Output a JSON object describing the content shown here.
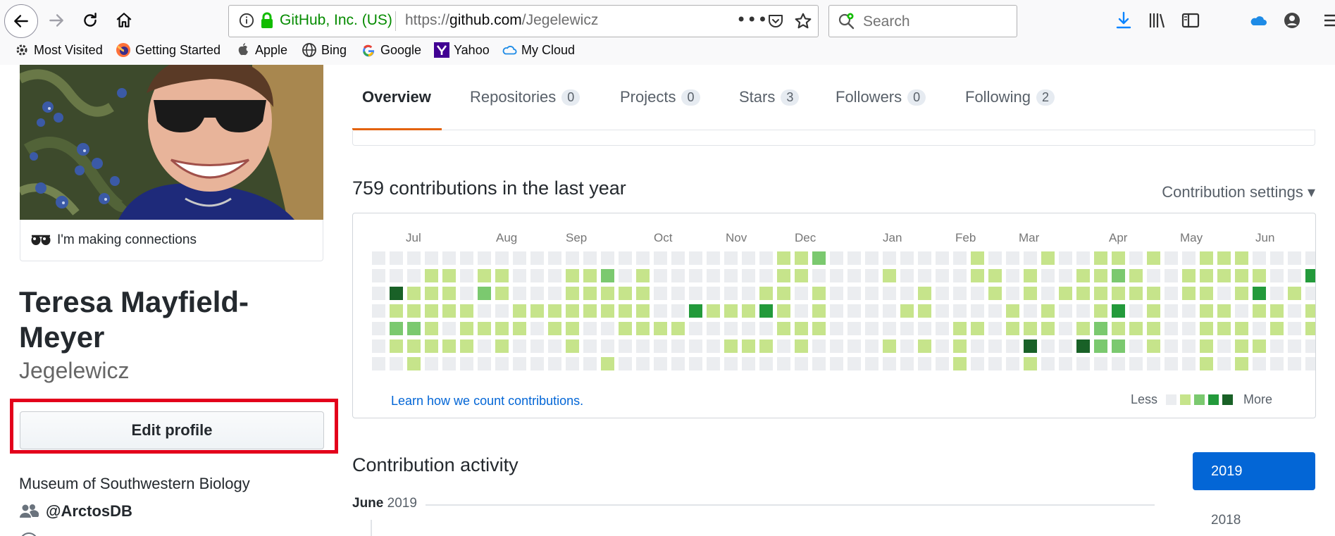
{
  "browser": {
    "url_org": "GitHub, Inc. (US)",
    "url_prefix": "https://",
    "url_host": "github.com",
    "url_path": "/Jegelewicz",
    "url_more": "•••",
    "search_placeholder": "Search",
    "bookmarks": [
      {
        "label": "Most Visited",
        "icon": "gear-icon"
      },
      {
        "label": "Getting Started",
        "icon": "firefox-icon"
      },
      {
        "label": "Apple",
        "icon": "apple-icon"
      },
      {
        "label": "Bing",
        "icon": "globe-icon"
      },
      {
        "label": "Google",
        "icon": "google-icon"
      },
      {
        "label": "Yahoo",
        "icon": "yahoo-icon"
      },
      {
        "label": "My Cloud",
        "icon": "cloud-icon"
      }
    ]
  },
  "profile": {
    "status": "I'm making connections",
    "full_name": "Teresa Mayfield-Meyer",
    "username": "Jegelewicz",
    "edit_button": "Edit profile",
    "organization": "Museum of Southwestern Biology",
    "org_handle": "@ArctosDB"
  },
  "tabs": [
    {
      "label": "Overview",
      "count": null,
      "active": true
    },
    {
      "label": "Repositories",
      "count": "0",
      "active": false
    },
    {
      "label": "Projects",
      "count": "0",
      "active": false
    },
    {
      "label": "Stars",
      "count": "3",
      "active": false
    },
    {
      "label": "Followers",
      "count": "0",
      "active": false
    },
    {
      "label": "Following",
      "count": "2",
      "active": false
    }
  ],
  "contributions": {
    "title": "759 contributions in the last year",
    "settings": "Contribution settings ▾",
    "learn_link": "Learn how we count contributions.",
    "legend_less": "Less",
    "legend_more": "More",
    "months": [
      "Jul",
      "Aug",
      "Sep",
      "Oct",
      "Nov",
      "Dec",
      "Jan",
      "Feb",
      "Mar",
      "Apr",
      "May",
      "Jun"
    ],
    "colors": [
      "#ebedf0",
      "#c6e48b",
      "#7bc96f",
      "#239a3b",
      "#196127"
    ],
    "levels": [
      [
        0,
        0,
        0,
        0,
        0,
        0,
        0
      ],
      [
        0,
        0,
        4,
        1,
        2,
        1,
        0
      ],
      [
        0,
        0,
        1,
        1,
        2,
        1,
        1
      ],
      [
        0,
        1,
        1,
        1,
        1,
        1,
        0
      ],
      [
        0,
        1,
        1,
        1,
        0,
        1,
        0
      ],
      [
        0,
        0,
        0,
        1,
        1,
        1,
        0
      ],
      [
        0,
        1,
        2,
        0,
        1,
        0,
        0
      ],
      [
        0,
        1,
        1,
        0,
        1,
        1,
        0
      ],
      [
        0,
        0,
        0,
        1,
        1,
        0,
        0
      ],
      [
        0,
        0,
        0,
        1,
        0,
        0,
        0
      ],
      [
        0,
        0,
        0,
        1,
        1,
        0,
        0
      ],
      [
        0,
        1,
        1,
        1,
        1,
        1,
        0
      ],
      [
        0,
        1,
        1,
        1,
        0,
        0,
        0
      ],
      [
        0,
        2,
        1,
        1,
        0,
        0,
        1
      ],
      [
        0,
        0,
        1,
        1,
        1,
        0,
        0
      ],
      [
        0,
        1,
        1,
        1,
        1,
        0,
        0
      ],
      [
        0,
        0,
        0,
        0,
        1,
        0,
        0
      ],
      [
        0,
        0,
        0,
        0,
        1,
        0,
        0
      ],
      [
        0,
        0,
        0,
        3,
        0,
        0,
        0
      ],
      [
        0,
        0,
        0,
        1,
        0,
        0,
        0
      ],
      [
        0,
        0,
        0,
        1,
        0,
        1,
        0
      ],
      [
        0,
        0,
        0,
        1,
        0,
        1,
        0
      ],
      [
        0,
        0,
        1,
        3,
        0,
        1,
        0
      ],
      [
        1,
        1,
        1,
        1,
        1,
        0,
        0
      ],
      [
        1,
        1,
        0,
        0,
        1,
        1,
        0
      ],
      [
        2,
        0,
        1,
        1,
        1,
        0,
        0
      ],
      [
        0,
        0,
        0,
        0,
        0,
        0,
        0
      ],
      [
        0,
        0,
        0,
        0,
        0,
        0,
        0
      ],
      [
        0,
        0,
        0,
        0,
        0,
        0,
        0
      ],
      [
        0,
        1,
        0,
        0,
        0,
        1,
        0
      ],
      [
        0,
        0,
        0,
        1,
        0,
        0,
        0
      ],
      [
        0,
        0,
        1,
        1,
        0,
        1,
        0
      ],
      [
        0,
        0,
        0,
        0,
        0,
        0,
        0
      ],
      [
        0,
        0,
        0,
        0,
        1,
        1,
        1
      ],
      [
        1,
        1,
        0,
        0,
        1,
        0,
        0
      ],
      [
        0,
        1,
        1,
        0,
        0,
        0,
        0
      ],
      [
        0,
        0,
        0,
        1,
        1,
        0,
        0
      ],
      [
        0,
        1,
        1,
        0,
        1,
        4,
        1
      ],
      [
        1,
        0,
        0,
        1,
        1,
        0,
        0
      ],
      [
        0,
        0,
        1,
        0,
        0,
        0,
        0
      ],
      [
        0,
        1,
        1,
        0,
        1,
        4,
        0
      ],
      [
        1,
        1,
        1,
        1,
        2,
        2,
        0
      ],
      [
        1,
        2,
        1,
        3,
        1,
        2,
        0
      ],
      [
        0,
        1,
        1,
        0,
        1,
        0,
        0
      ],
      [
        1,
        0,
        1,
        1,
        1,
        1,
        0
      ],
      [
        0,
        0,
        0,
        0,
        0,
        0,
        0
      ],
      [
        0,
        1,
        1,
        0,
        0,
        0,
        0
      ],
      [
        1,
        1,
        1,
        1,
        1,
        1,
        1
      ],
      [
        1,
        1,
        0,
        1,
        1,
        0,
        0
      ],
      [
        1,
        1,
        1,
        0,
        1,
        1,
        1
      ],
      [
        0,
        1,
        3,
        1,
        0,
        1,
        0
      ],
      [
        0,
        0,
        0,
        1,
        1,
        0,
        0
      ],
      [
        0,
        0,
        1,
        0,
        0,
        0,
        0
      ],
      [
        0,
        3,
        0,
        1,
        1,
        0,
        0
      ]
    ]
  },
  "activity": {
    "title": "Contribution activity",
    "month": "June",
    "year": "2019",
    "years": [
      "2019",
      "2018"
    ]
  }
}
